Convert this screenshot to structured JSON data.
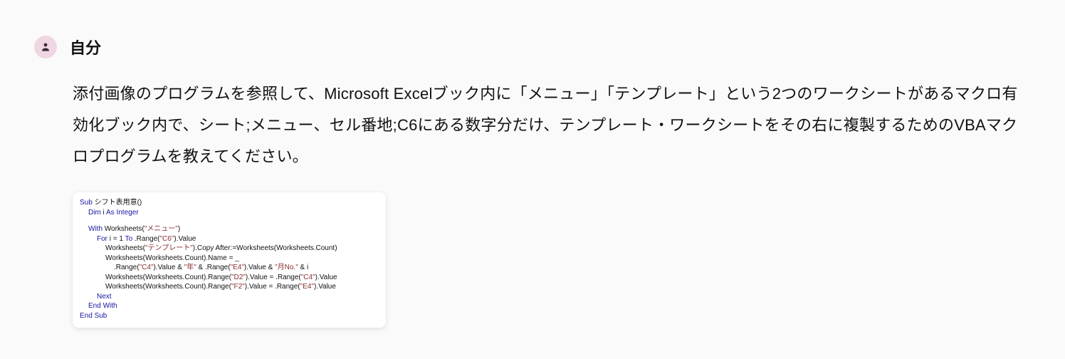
{
  "author": "自分",
  "message": "添付画像のプログラムを参照して、Microsoft Excelブック内に「メニュー」「テンプレート」という2つのワークシートがあるマクロ有効化ブック内で、シート;メニュー、セル番地;C6にある数字分だけ、テンプレート・ワークシートをその右に複製するためのVBAマクロプログラムを教えてください。",
  "code": {
    "line01_sub": "Sub",
    "line01_name": " シフト表用意()",
    "line02_dim": "Dim",
    "line02_rest": " i ",
    "line02_as": "As Integer",
    "line04_with": "With",
    "line04_rest": " Worksheets(",
    "line04_str": "\"メニュー\"",
    "line04_close": ")",
    "line05_for": "For",
    "line05_rest": " i = 1 ",
    "line05_to": "To",
    "line05_rest2": " .Range(",
    "line05_str": "\"C6\"",
    "line05_close": ").Value",
    "line06_a": "Worksheets(",
    "line06_str1": "\"テンプレート\"",
    "line06_b": ").Copy After:=Worksheets(Worksheets.Count)",
    "line07": "Worksheets(Worksheets.Count).Name = _",
    "line08_a": ".Range(",
    "line08_s1": "\"C4\"",
    "line08_b": ").Value & ",
    "line08_s2": "\"年\"",
    "line08_c": " & .Range(",
    "line08_s3": "\"E4\"",
    "line08_d": ").Value & ",
    "line08_s4": "\"月No.\"",
    "line08_e": " & i",
    "line09_a": "Worksheets(Worksheets.Count).Range(",
    "line09_s1": "\"D2\"",
    "line09_b": ").Value = .Range(",
    "line09_s2": "\"C4\"",
    "line09_c": ").Value",
    "line10_a": "Worksheets(Worksheets.Count).Range(",
    "line10_s1": "\"F2\"",
    "line10_b": ").Value = .Range(",
    "line10_s2": "\"E4\"",
    "line10_c": ").Value",
    "line11_next": "Next",
    "line12_endwith": "End With",
    "line13_endsub": "End Sub"
  }
}
